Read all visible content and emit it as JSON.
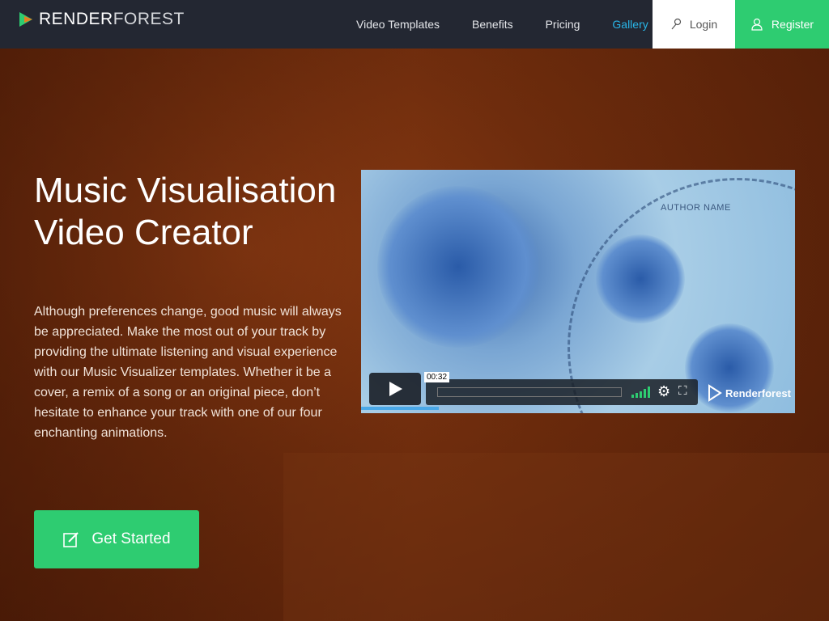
{
  "header": {
    "logo": {
      "bold": "RENDER",
      "light": "FOREST"
    },
    "nav": [
      {
        "label": "Video Templates"
      },
      {
        "label": "Benefits"
      },
      {
        "label": "Pricing"
      },
      {
        "label": "Gallery",
        "active": true
      }
    ],
    "login": "Login",
    "register": "Register"
  },
  "hero": {
    "title_line1": "Music Visualisation",
    "title_line2": "Video Creator",
    "description": "Although preferences change, good music will always be appreciated. Make the most out of your track by providing the ultimate listening and visual experience with our Music Visualizer templates. Whether it be a cover, a remix of a song or an original piece, don’t hesitate to enhance your track with one of our four enchanting animations.",
    "cta": "Get Started"
  },
  "video": {
    "overlay_text": "AUTHOR NAME",
    "tooltip_time": "00:32",
    "brand": "Renderforest",
    "progress_percent": 18,
    "volume_level": 5
  },
  "colors": {
    "accent": "#2ecc71",
    "active_nav": "#29b6e8",
    "header_bg": "#232732"
  }
}
